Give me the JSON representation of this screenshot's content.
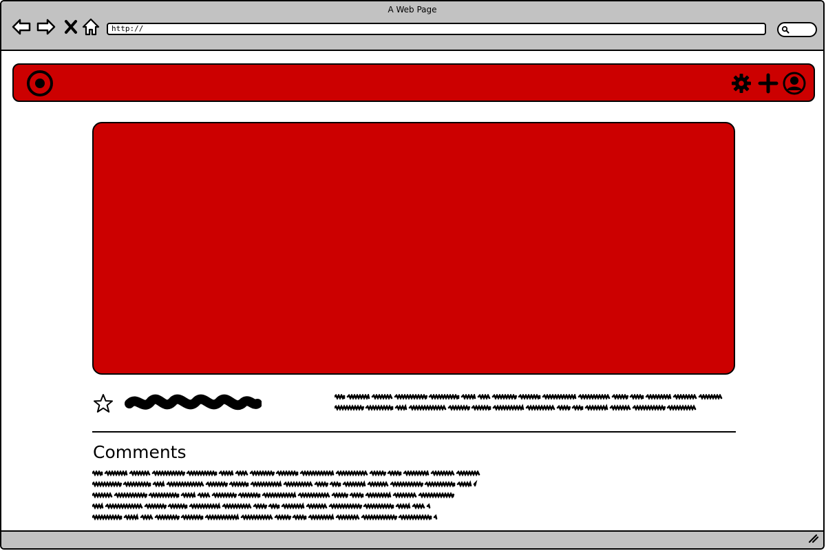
{
  "browser": {
    "window_title": "A Web Page",
    "url": "http://",
    "nav_icons": [
      "back-arrow-icon",
      "forward-arrow-icon",
      "close-x-icon",
      "home-icon"
    ],
    "search_icon": "search-icon"
  },
  "app_bar": {
    "background_color": "#cc0000",
    "logo_icon": "target-logo-icon",
    "right_icons": [
      "gear-icon",
      "plus-icon",
      "user-avatar-icon"
    ]
  },
  "hero": {
    "background_color": "#cc0000"
  },
  "post": {
    "favorite_icon": "star-icon"
  },
  "comments": {
    "heading": "Comments"
  },
  "colors": {
    "chrome_gray": "#c2c2c2",
    "accent_red": "#cc0000",
    "ink": "#000000"
  }
}
